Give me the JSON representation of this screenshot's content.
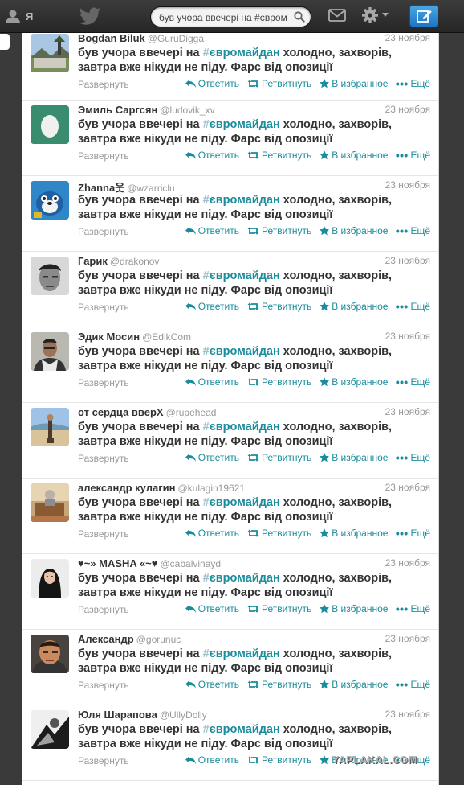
{
  "topbar": {
    "me_label": "Я",
    "search_value": "був учора ввечері на #євромайдан",
    "colors": {
      "bar": "#2d2d2d",
      "compose": "#2f8fd8"
    }
  },
  "tweet_text": {
    "before": "був учора ввечері на ",
    "hash": "#",
    "tag": "євромайдан",
    "after": " холодно, захворів, завтра вже нікуди не піду. Фарс від опозиції"
  },
  "labels": {
    "expand": "Развернуть",
    "reply": "Ответить",
    "retweet": "Ретвитнуть",
    "favorite": "В избранное",
    "more": "Ещё"
  },
  "tweets": [
    {
      "name": "Bogdan Biluk",
      "handle": "@GuruDigga",
      "date": "23 ноября",
      "avatar": "landscape"
    },
    {
      "name": "Эмиль Саргсян",
      "handle": "@ludovik_xv",
      "date": "23 ноября",
      "avatar": "egg"
    },
    {
      "name": "Zhanna웃",
      "handle": "@wzarriclu",
      "date": "23 ноября",
      "avatar": "toy"
    },
    {
      "name": "Гарик",
      "handle": "@drakonov",
      "date": "23 ноября",
      "avatar": "face-bw"
    },
    {
      "name": "Эдик Мосин",
      "handle": "@EdikCom",
      "date": "23 ноября",
      "avatar": "man"
    },
    {
      "name": "от сердца вверХ",
      "handle": "@rupehead",
      "date": "23 ноября",
      "avatar": "beach"
    },
    {
      "name": "александр кулагин",
      "handle": "@kulagin19621",
      "date": "23 ноября",
      "avatar": "room"
    },
    {
      "name": "♥~» MASHA «~♥",
      "handle": "@cabalvinayd",
      "date": "23 ноября",
      "avatar": "girl"
    },
    {
      "name": "Александр",
      "handle": "@gorunuc",
      "date": "23 ноября",
      "avatar": "face-color"
    },
    {
      "name": "Юля Шарапова",
      "handle": "@UllyDolly",
      "date": "23 ноября",
      "avatar": "bw-photo"
    }
  ],
  "watermark": "YAPLAKAL.COM"
}
